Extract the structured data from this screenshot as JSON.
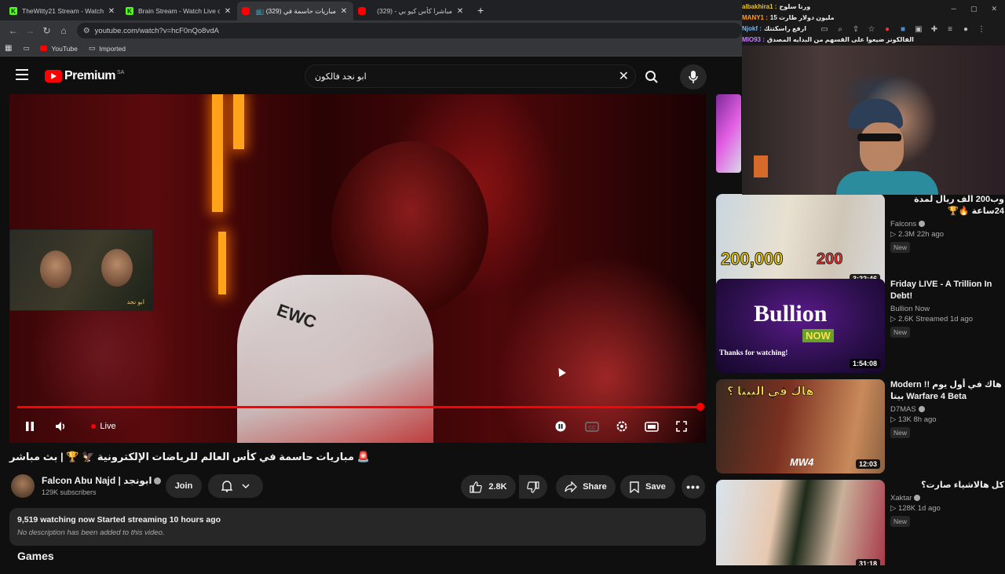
{
  "tabs": [
    {
      "title": "TheWitty21 Stream - Watch Live",
      "favicon": "kick-icon",
      "active": false
    },
    {
      "title": "Brain Stream - Watch Live on K",
      "favicon": "kick-icon",
      "active": false
    },
    {
      "title": "مباريات حاسمة في (329) 📺",
      "favicon": "youtube-icon",
      "active": true
    },
    {
      "title": "مباشرا كأس كيو بي - (329)",
      "favicon": "youtube-icon",
      "active": false
    }
  ],
  "toolbar": {
    "url": "youtube.com/watch?v=hcF0nQo8vdA"
  },
  "bookmarks": [
    {
      "label": "YouTube",
      "icon": "youtube-icon"
    },
    {
      "label": "Imported",
      "icon": "folder-icon"
    }
  ],
  "masthead": {
    "logo_word": "Premium",
    "country": "SA",
    "search_value": "ابو نجد فالكون"
  },
  "player": {
    "live_label": "Live",
    "jersey_text": "EWC",
    "pip_mark": "ابو نجد",
    "progress": 1.0
  },
  "video": {
    "title": "🚨 مباريات حاسمة في كأس العالم للرياضات الإلكترونية 🦅 🏆 | بث مباشر",
    "channel": "Falcon Abu Najd | ابونجد",
    "subscribers": "129K subscribers",
    "join_label": "Join",
    "like_count": "2.8K",
    "share_label": "Share",
    "save_label": "Save",
    "stats": "9,519 watching now  Started streaming 10 hours ago",
    "no_description": "No description has been added to this video.",
    "section_title": "Games"
  },
  "overlay": {
    "chat": [
      {
        "user": "albakhira1 :",
        "msg": "ورنا سلوح",
        "color": "#e6c22e"
      },
      {
        "user": "MANY1 :",
        "msg": "15 مليون دولار طارت",
        "color": "#ff9a2e"
      },
      {
        "user": "Njokf :",
        "msg": "ارفع راسكتتك",
        "color": "#6fb7ff"
      },
      {
        "user": "MIO93 :",
        "msg": "الفالكونز ضيعوا على القسهم من البدايه المصدق",
        "color": "#c77dff"
      }
    ]
  },
  "recommendations": [
    {
      "title": "وب200 الف ريال لمدة 24ساعة 🔥🏆",
      "channel": "Falcons",
      "verified": true,
      "stats": "▷ 2.3M  22h ago",
      "badge": "New",
      "duration": "3:22:46",
      "thumb_text": "200,000",
      "thumb_text2": "200",
      "thumb_colors": [
        "#8bc34a",
        "#f5d66b",
        "#e2e2e2"
      ]
    },
    {
      "title": "Friday LIVE - A Trillion In Debt!",
      "channel": "Bullion Now",
      "verified": false,
      "stats": "▷ 2.6K  Streamed 1d ago",
      "badge": "New",
      "duration": "1:54:08",
      "thumb_text": "Bullion",
      "thumb_text2": "NOW",
      "thumb_caption": "Thanks for watching!",
      "thumb_colors": [
        "#2a0f4a",
        "#5a1a8a",
        "#1a0830"
      ]
    },
    {
      "title": "Modern !! هاك في أول يوم بيتا Warfare 4 Beta",
      "channel": "D7MAS",
      "verified": true,
      "stats": "▷ 13K  8h ago",
      "badge": "New",
      "duration": "12:03",
      "thumb_text": "هاك في البيتا ؟",
      "thumb_text2": "MW4",
      "thumb_colors": [
        "#3a2a20",
        "#7a3020",
        "#c98a5a"
      ]
    },
    {
      "title": "كل هالاشياء صارت؟",
      "channel": "Xaktar",
      "verified": true,
      "stats": "▷ 128K  1d ago",
      "badge": "New",
      "duration": "31:18",
      "thumb_colors": [
        "#d9e4ee",
        "#e8c9b0",
        "#1e2a1a"
      ]
    }
  ]
}
